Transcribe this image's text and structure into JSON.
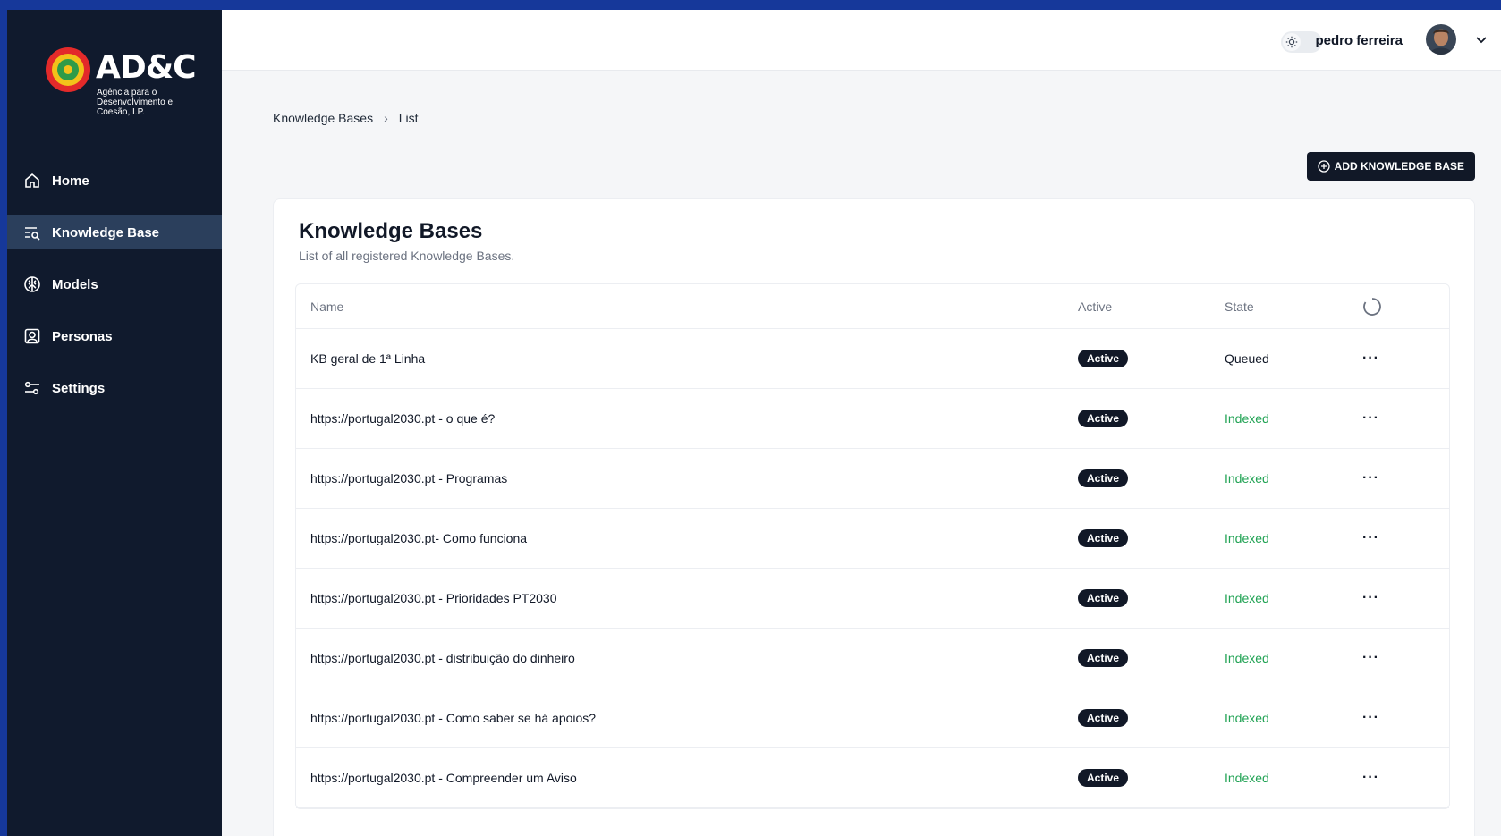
{
  "brand": {
    "name": "AD&C",
    "subtitle": "Agência para o Desenvolvimento e Coesão, I.P."
  },
  "sidebar": {
    "items": [
      {
        "label": "Home",
        "icon": "home-icon"
      },
      {
        "label": "Knowledge Base",
        "icon": "knowledge-base-icon",
        "active": true
      },
      {
        "label": "Models",
        "icon": "brain-icon"
      },
      {
        "label": "Personas",
        "icon": "persona-icon"
      },
      {
        "label": "Settings",
        "icon": "settings-sliders-icon"
      }
    ]
  },
  "topbar": {
    "user_name": "pedro ferreira",
    "theme_icon": "sun-icon"
  },
  "breadcrumb": [
    "Knowledge Bases",
    "List"
  ],
  "actions": {
    "add_label": "ADD KNOWLEDGE BASE"
  },
  "card": {
    "title": "Knowledge Bases",
    "subtitle": "List of all registered Knowledge Bases."
  },
  "table": {
    "headers": {
      "name": "Name",
      "active": "Active",
      "state": "State"
    },
    "rows": [
      {
        "name": "KB geral de 1ª Linha",
        "active": "Active",
        "state": "Queued"
      },
      {
        "name": "https://portugal2030.pt - o que é?",
        "active": "Active",
        "state": "Indexed"
      },
      {
        "name": "https://portugal2030.pt - Programas",
        "active": "Active",
        "state": "Indexed"
      },
      {
        "name": "https://portugal2030.pt- Como funciona",
        "active": "Active",
        "state": "Indexed"
      },
      {
        "name": "https://portugal2030.pt - Prioridades PT2030",
        "active": "Active",
        "state": "Indexed"
      },
      {
        "name": "https://portugal2030.pt - distribuição do dinheiro",
        "active": "Active",
        "state": "Indexed"
      },
      {
        "name": "https://portugal2030.pt - Como saber se há apoios?",
        "active": "Active",
        "state": "Indexed"
      },
      {
        "name": "https://portugal2030.pt - Compreender um Aviso",
        "active": "Active",
        "state": "Indexed"
      }
    ]
  },
  "colors": {
    "sidebar_bg": "#101a2d",
    "sidebar_active": "#2b3f5c",
    "indexed": "#22a355",
    "badge_bg": "#111827",
    "outer_border": "#16389a"
  }
}
